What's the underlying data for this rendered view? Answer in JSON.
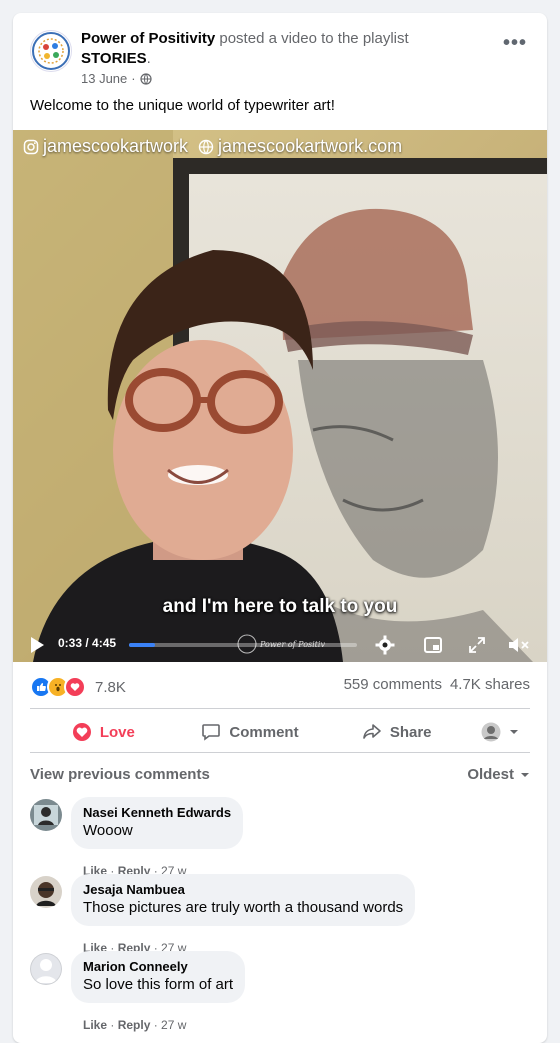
{
  "post": {
    "page_name": "Power of Positivity",
    "action_text": "posted a video to the playlist",
    "playlist": "STORIES",
    "date": "13 June",
    "separator": "·",
    "caption": "Welcome to the unique world of typewriter art!"
  },
  "video": {
    "watermark_instagram": "jamescookartwork",
    "watermark_site": "jamescookartwork.com",
    "subtitle": "and I'm here to talk to you",
    "time": "0:33 / 4:45",
    "progress": 0.1158,
    "overlay_logo_text": "Power of Positivity"
  },
  "engagement": {
    "reaction_count": "7.8K",
    "comments": "559 comments",
    "shares": "4.7K shares"
  },
  "actions": {
    "love": "Love",
    "comment": "Comment",
    "share": "Share"
  },
  "comments_section": {
    "view_previous": "View previous comments",
    "sort": "Oldest",
    "items": [
      {
        "author": "Nasei Kenneth Edwards",
        "text": "Wooow",
        "like": "Like",
        "reply": "Reply",
        "age": "27 w"
      },
      {
        "author": "Jesaja Nambuea",
        "text": "Those pictures are truly worth a thousand words",
        "like": "Like",
        "reply": "Reply",
        "age": "27 w"
      },
      {
        "author": "Marion Conneely",
        "text": "So love this form of art",
        "like": "Like",
        "reply": "Reply",
        "age": "27 w"
      }
    ]
  },
  "colors": {
    "love": "#f33e58",
    "like_blue": "#1877f2",
    "muted": "#65676b",
    "progress": "#3b82f6"
  }
}
